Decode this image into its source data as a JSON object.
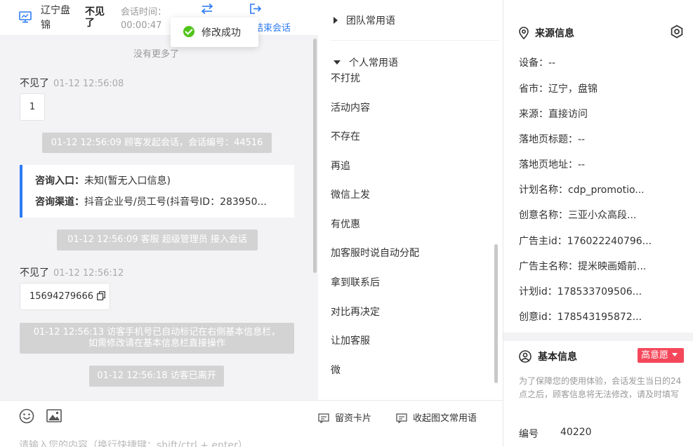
{
  "header": {
    "location": "辽宁盘锦",
    "visitor_name": "不见了",
    "session_time_label": "会话时间：",
    "session_time_value": "00:00:47",
    "end_session_label": "结束会话"
  },
  "toast": {
    "message": "修改成功"
  },
  "chat": {
    "no_more": "没有更多了",
    "messages": [
      {
        "sender": "不见了",
        "time": "01-12 12:56:08",
        "text": "1"
      },
      {
        "sender": "不见了",
        "time": "01-12 12:56:12",
        "text": "15694279666"
      }
    ],
    "system": [
      "01-12 12:56:09 顾客发起会话，会话编号：44516",
      "01-12 12:56:09 客服 超级管理员 接入会话",
      "01-12 12:56:13 访客手机号已自动标记在右侧基本信息栏，",
      "如需修改请在基本信息栏直接操作",
      "01-12 12:56:18 访客已离开"
    ],
    "entry_card": {
      "entry_label": "咨询入口：",
      "entry_value": "未知(暂无入口信息)",
      "channel_label": "咨询渠道：",
      "channel_value": "抖音企业号/员工号(抖音号ID：283950..."
    }
  },
  "footer": {
    "input_placeholder": "请输入您的内容（换行快捷键：shift/ctrl + enter）"
  },
  "phrases": {
    "team_group": "团队常用语",
    "personal_group": "个人常用语",
    "items": [
      "不打扰",
      "活动内容",
      "不存在",
      "再追",
      "微信上发",
      "有优惠",
      "加客服时说自动分配",
      "拿到联系后",
      "对比再决定",
      "让加客服",
      "微"
    ],
    "card_button": "留资卡片",
    "collapse_button": "收起图文常用语"
  },
  "source_info": {
    "title": "来源信息",
    "fields": [
      {
        "label": "设备：",
        "value": "--"
      },
      {
        "label": "省市：",
        "value": "辽宁，盘锦"
      },
      {
        "label": "来源：",
        "value": "直接访问"
      },
      {
        "label": "落地页标题：",
        "value": "--"
      },
      {
        "label": "落地页地址：",
        "value": "--"
      },
      {
        "label": "计划名称：",
        "value": "cdp_promotio..."
      },
      {
        "label": "创意名称：",
        "value": "三亚小众高段..."
      },
      {
        "label": "广告主id：",
        "value": "176022240796..."
      },
      {
        "label": "广告主名称：",
        "value": "提米映画婚前..."
      },
      {
        "label": "计划id：",
        "value": "178533709506..."
      },
      {
        "label": "创意id：",
        "value": "178543195872..."
      }
    ]
  },
  "basic_info": {
    "title": "基本信息",
    "intent_badge": "高意愿",
    "notice": "为了保障您的使用体验，会话发生当日的24点之后，顾客信息将无法修改，请及时填写",
    "id_label": "编号",
    "id_value": "40220"
  },
  "colors": {
    "accent": "#2d7bf4",
    "success": "#52c41a",
    "badge": "#f5475b",
    "system_bg": "#d3d3d3"
  }
}
